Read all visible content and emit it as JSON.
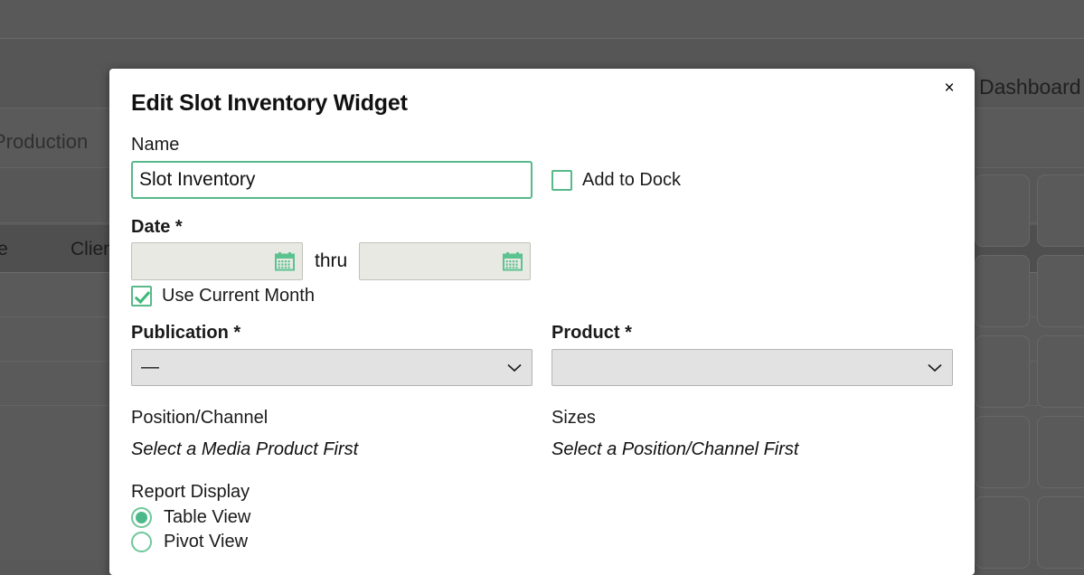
{
  "background": {
    "nav_label": "Production",
    "dashboard_label": "Dashboard",
    "table_headers": [
      "ize",
      "Clien"
    ],
    "card_count": 10
  },
  "modal": {
    "title": "Edit Slot Inventory Widget",
    "close_label": "×",
    "name": {
      "label": "Name",
      "value": "Slot Inventory",
      "placeholder": ""
    },
    "add_to_dock": {
      "label": "Add to Dock",
      "checked": false
    },
    "date": {
      "label": "Date *",
      "from_value": "",
      "to_value": "",
      "separator": "thru",
      "from_placeholder": "",
      "to_placeholder": "",
      "calendar_icon": "calendar-icon"
    },
    "use_current_month": {
      "label": "Use Current Month",
      "checked": true
    },
    "publication": {
      "label": "Publication *",
      "selected": "—"
    },
    "product": {
      "label": "Product *",
      "selected": ""
    },
    "position_channel": {
      "label": "Position/Channel",
      "hint": "Select a Media Product First"
    },
    "sizes": {
      "label": "Sizes",
      "hint": "Select a Position/Channel First"
    },
    "report_display": {
      "label": "Report Display",
      "options": [
        {
          "label": "Table View",
          "selected": true
        },
        {
          "label": "Pivot View",
          "selected": false
        }
      ]
    }
  },
  "colors": {
    "accent_green": "#4cb98b",
    "border_green": "#58b98a",
    "backdrop": "#5a5a5a",
    "modal_bg": "#ffffff",
    "disabled_field": "#e9e9e4",
    "select_bg": "#e2e2e2"
  }
}
